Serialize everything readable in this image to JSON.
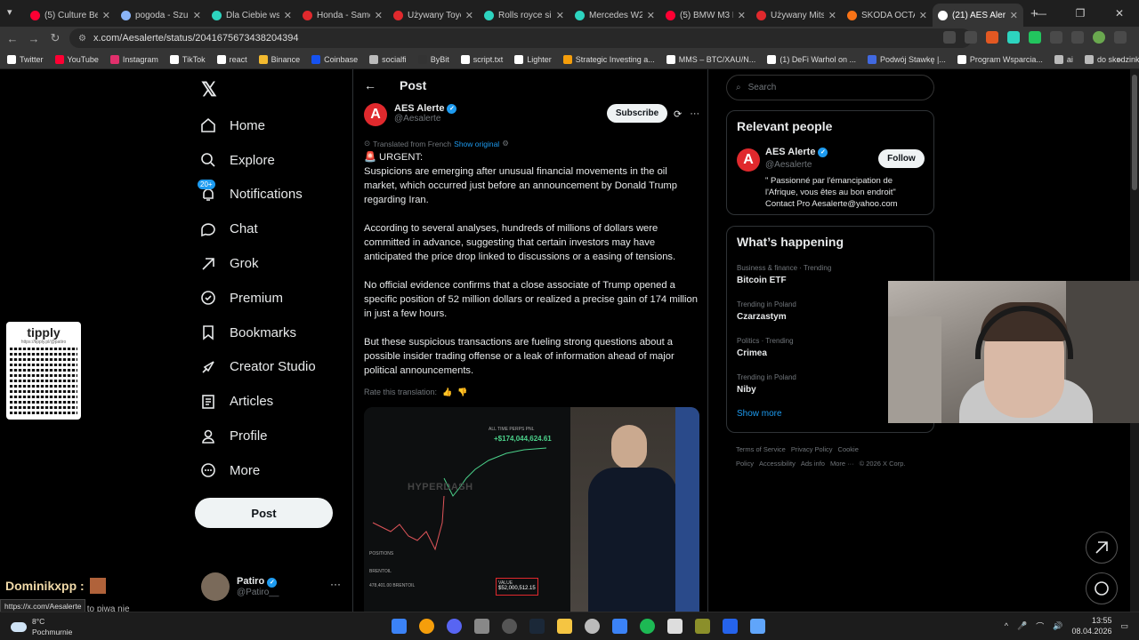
{
  "browser": {
    "tabs": [
      {
        "label": "(5) Culture Bea",
        "color": "#ff0033"
      },
      {
        "label": "pogoda - Szuk",
        "color": "#8ab4f8"
      },
      {
        "label": "Dla Ciebie wsz",
        "color": "#2dd4bf"
      },
      {
        "label": "Honda - Samo",
        "color": "#e0292d"
      },
      {
        "label": "Używany Toyot",
        "color": "#e0292d"
      },
      {
        "label": "Rolls royce silv",
        "color": "#2dd4bf"
      },
      {
        "label": "Mercedes W22",
        "color": "#2dd4bf"
      },
      {
        "label": "(5) BMW M3 E",
        "color": "#ff0033"
      },
      {
        "label": "Używany Mitsu",
        "color": "#e0292d"
      },
      {
        "label": "SKODA OCTAV",
        "color": "#f97316"
      },
      {
        "label": "(21) AES Alerte",
        "color": "#ffffff",
        "active": true
      }
    ],
    "url": "x.com/Aesalerte/status/2041675673438204394",
    "bookmarks": [
      {
        "label": "Twitter",
        "color": "#ffffff"
      },
      {
        "label": "YouTube",
        "color": "#ff0033"
      },
      {
        "label": "Instagram",
        "color": "#e1306c"
      },
      {
        "label": "TikTok",
        "color": "#ffffff"
      },
      {
        "label": "react",
        "color": "#ffffff"
      },
      {
        "label": "Binance",
        "color": "#f3ba2f"
      },
      {
        "label": "Coinbase",
        "color": "#1652f0"
      },
      {
        "label": "socialfi",
        "color": "#bbbbbb"
      },
      {
        "label": "ByBit",
        "color": "#333333"
      },
      {
        "label": "script.txt",
        "color": "#ffffff"
      },
      {
        "label": "Lighter",
        "color": "#ffffff"
      },
      {
        "label": "Strategic Investing a...",
        "color": "#f59e0b"
      },
      {
        "label": "MMS – BTC/XAU/N...",
        "color": "#ffffff"
      },
      {
        "label": "(1) DeFi Warhol on ...",
        "color": "#ffffff"
      },
      {
        "label": "Podwój Stawkę |...",
        "color": "#4169e1"
      },
      {
        "label": "Program Wsparcia...",
        "color": "#ffffff"
      },
      {
        "label": "ai",
        "color": "#bbbbbb"
      },
      {
        "label": "do skodzinki",
        "color": "#bbbbbb"
      }
    ]
  },
  "sidebar": {
    "items": [
      {
        "label": "Home",
        "icon": "home-icon"
      },
      {
        "label": "Explore",
        "icon": "search-icon"
      },
      {
        "label": "Notifications",
        "icon": "bell-icon",
        "badge": "20+"
      },
      {
        "label": "Chat",
        "icon": "chat-icon"
      },
      {
        "label": "Grok",
        "icon": "grok-icon"
      },
      {
        "label": "Premium",
        "icon": "premium-icon"
      },
      {
        "label": "Bookmarks",
        "icon": "bookmark-icon"
      },
      {
        "label": "Creator Studio",
        "icon": "rocket-icon"
      },
      {
        "label": "Articles",
        "icon": "article-icon"
      },
      {
        "label": "Profile",
        "icon": "person-icon"
      },
      {
        "label": "More",
        "icon": "more-icon"
      }
    ],
    "post_label": "Post",
    "account": {
      "name": "Patiro",
      "handle": "@Patiro__"
    }
  },
  "post": {
    "header": "Post",
    "author_name": "AES Alerte",
    "author_handle": "@Aesalerte",
    "subscribe_label": "Subscribe",
    "translated_from": "Translated from French",
    "show_original": "Show original",
    "urgent": "🚨 URGENT:",
    "paragraphs": [
      "Suspicions are emerging after unusual financial movements in the oil market, which occurred just before an announcement by Donald Trump regarding Iran.",
      "According to several analyses, hundreds of millions of dollars were committed in advance, suggesting that certain investors may have anticipated the price drop linked to discussions or a easing of tensions.",
      "No official evidence confirms that a close associate of Trump opened a specific position of 52 million dollars or realized a precise gain of 174 million in just a few hours.",
      "But these suspicious transactions are fueling strong questions about a possible insider trading offense or a leak of information ahead of major political announcements."
    ],
    "rate_translation": "Rate this translation:",
    "media": {
      "pnl_label": "ALL TIME PERPS PNL",
      "pnl_value": "+$174,044,624.61",
      "watermark": "HYPERDASH",
      "value_label": "VALUE",
      "value_amount": "$52,000,512.15",
      "tab_positions": "POSITIONS",
      "asset": "BRENTOIL",
      "size": "478,401.00 BRENTOIL"
    }
  },
  "right": {
    "search_placeholder": "Search",
    "relevant_title": "Relevant people",
    "person": {
      "name": "AES Alerte",
      "handle": "@Aesalerte",
      "bio": "\" Passionné par l'émancipation de l'Afrique, vous êtes au bon endroit\" Contact Pro Aesalerte@yahoo.com",
      "follow_label": "Follow"
    },
    "happening_title": "What’s happening",
    "trends": [
      {
        "category": "Business & finance · Trending",
        "title": "Bitcoin ETF"
      },
      {
        "category": "Trending in Poland",
        "title": "Czarzastym"
      },
      {
        "category": "Politics · Trending",
        "title": "Crimea"
      },
      {
        "category": "Trending in Poland",
        "title": "Niby"
      }
    ],
    "show_more": "Show more",
    "footer": [
      "Terms of Service",
      "Privacy Policy",
      "Cookie Policy",
      "Accessibility",
      "Ads info",
      "More ···",
      "© 2026 X Corp."
    ]
  },
  "overlay": {
    "tipply_title": "tipply",
    "tipply_url": "https://tipply.pl/@patiro",
    "chat_user": "Dominikxpp :",
    "chat_line2": "lasos1 : za 10zł to piwa nie",
    "status_url": "https://x.com/Aesalerte"
  },
  "taskbar": {
    "temp": "8°C",
    "weather": "Pochmurnie",
    "time": "13:55",
    "date": "08.04.2026"
  }
}
